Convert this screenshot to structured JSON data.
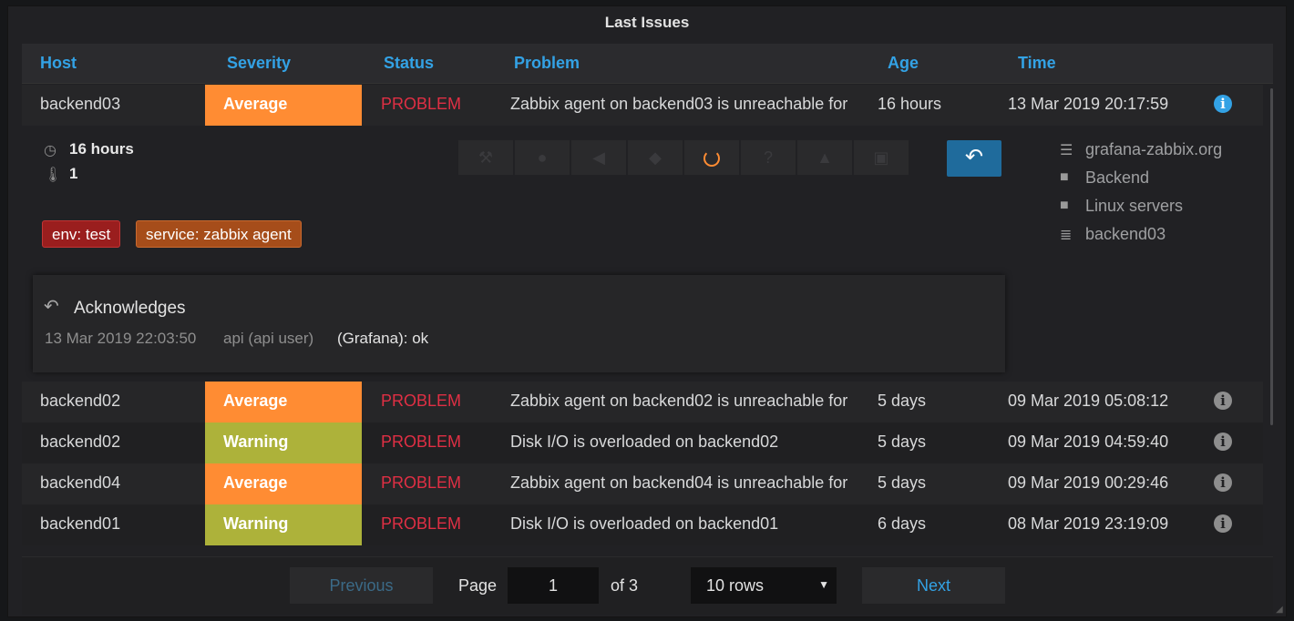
{
  "panel": {
    "title": "Last Issues"
  },
  "table": {
    "columns": [
      "Host",
      "Severity",
      "Status",
      "Problem",
      "Age",
      "Time"
    ],
    "rows": [
      {
        "host": "backend03",
        "severity": "Average",
        "status": "PROBLEM",
        "problem": "Zabbix agent on backend03 is unreachable for",
        "age": "16 hours",
        "time": "13 Mar 2019 20:17:59"
      },
      {
        "host": "backend02",
        "severity": "Average",
        "status": "PROBLEM",
        "problem": "Zabbix agent on backend02 is unreachable for",
        "age": "5 days",
        "time": "09 Mar 2019 05:08:12"
      },
      {
        "host": "backend02",
        "severity": "Warning",
        "status": "PROBLEM",
        "problem": "Disk I/O is overloaded on backend02",
        "age": "5 days",
        "time": "09 Mar 2019 04:59:40"
      },
      {
        "host": "backend04",
        "severity": "Average",
        "status": "PROBLEM",
        "problem": "Zabbix agent on backend04 is unreachable for",
        "age": "5 days",
        "time": "09 Mar 2019 00:29:46"
      },
      {
        "host": "backend01",
        "severity": "Warning",
        "status": "PROBLEM",
        "problem": "Disk I/O is overloaded on backend01",
        "age": "6 days",
        "time": "08 Mar 2019 23:19:09"
      }
    ]
  },
  "details": {
    "age": "16 hours",
    "priority": "1",
    "tags": [
      "env: test",
      "service: zabbix agent"
    ],
    "groups": [
      "grafana-zabbix.org",
      "Backend",
      "Linux servers",
      "backend03"
    ],
    "acknowledges": {
      "title": "Acknowledges",
      "time": "13 Mar 2019 22:03:50",
      "user": "api (api user)",
      "message": "(Grafana): ok"
    }
  },
  "pager": {
    "previous": "Previous",
    "page_label": "Page",
    "page_value": "1",
    "of_label": "of 3",
    "rows_option": "10 rows",
    "next": "Next"
  },
  "colors": {
    "average": "#ff8c33",
    "warning": "#adb23a",
    "problem": "#e02f44",
    "accent": "#33a2e5"
  }
}
